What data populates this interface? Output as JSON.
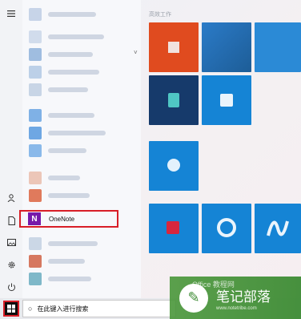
{
  "start_menu": {
    "tiles_header": "高效工作",
    "highlighted_app": "OneNote",
    "onenote_icon_glyph": "N",
    "rail_icons": [
      "hamburger-icon",
      "user-icon",
      "document-icon",
      "pictures-icon",
      "settings-icon",
      "power-icon"
    ],
    "colors": {
      "tile_blue": "#1584d5",
      "tile_orange": "#e04b1f",
      "tile_purple": "#7719aa",
      "highlight_red": "#d81e27"
    }
  },
  "taskbar": {
    "search_placeholder": "在此键入进行搜索",
    "search_icon": "○"
  },
  "watermark": {
    "title": "笔记部落",
    "url": "www.notetribe.com",
    "brand": "Office 教程网"
  }
}
